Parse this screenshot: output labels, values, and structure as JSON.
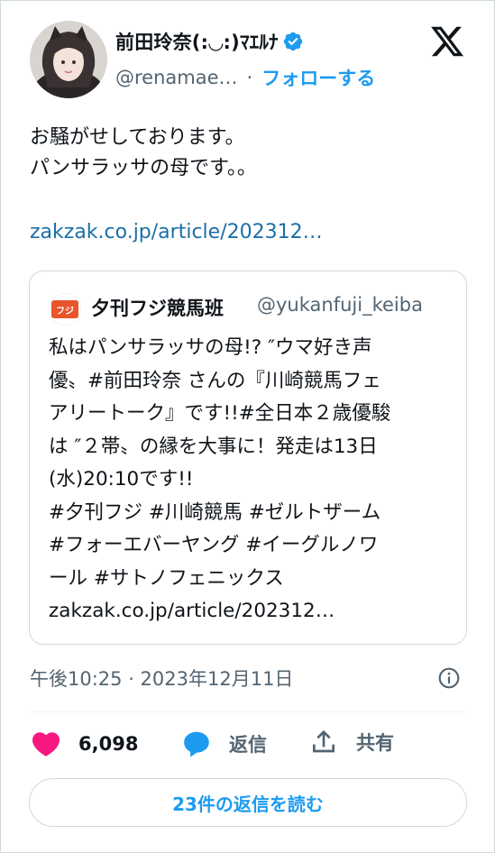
{
  "author": {
    "name": "前田玲奈(:◡:)ﾏｴﾙﾅ",
    "handle": "@renamae…",
    "separator": "·",
    "follow_label": "フォローする",
    "verified": true
  },
  "tweet": {
    "lines": [
      "お騒がせしております。",
      "パンサラッサの母です。。"
    ],
    "link": "zakzak.co.jp/article/202312…"
  },
  "quote": {
    "name": "夕刊フジ競馬班",
    "handle": "@yukanfuji_keiba",
    "avatar_text": "夕刊フジ",
    "lines": [
      "私はパンサラッサの母!? ″ウマ好き声",
      "優〟#前田玲奈 さんの『川崎競馬フェ",
      "アリートーク』です!!#全日本２歳優駿",
      "は ″２帯〟の縁を大事に！発走は13日",
      "(水)20:10です!!",
      "#夕刊フジ #川崎競馬 #ゼルトザーム",
      "#フォーエバーヤング #イーグルノワ",
      "ール #サトノフェニックス",
      "zakzak.co.jp/article/202312…"
    ]
  },
  "timestamp": "午後10:25 · 2023年12月11日",
  "actions": {
    "likes": "6,098",
    "reply_label": "返信",
    "share_label": "共有"
  },
  "read_replies_label": "23件の返信を読む",
  "colors": {
    "accent": "#1d9bf0",
    "like": "#f91880",
    "link": "#1b6fa8"
  }
}
